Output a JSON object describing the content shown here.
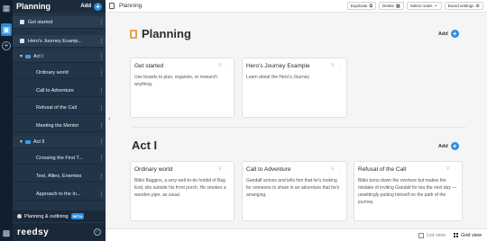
{
  "sidebar": {
    "title": "Planning",
    "add_label": "Add",
    "items": [
      {
        "label": "Get started",
        "kind": "board"
      },
      {
        "label": "Hero's Journey Examp...",
        "kind": "board"
      },
      {
        "label": "Act I",
        "kind": "section"
      },
      {
        "label": "Ordinary world",
        "kind": "card"
      },
      {
        "label": "Call to Adventure",
        "kind": "card"
      },
      {
        "label": "Refusal of the Call",
        "kind": "card"
      },
      {
        "label": "Meeting the Mentor",
        "kind": "card"
      },
      {
        "label": "Act II",
        "kind": "section"
      },
      {
        "label": "Crossing the First T...",
        "kind": "card"
      },
      {
        "label": "Test, Allies, Enemies",
        "kind": "card"
      },
      {
        "label": "Approach to the In...",
        "kind": "card"
      }
    ],
    "footer": {
      "planning_label": "Planning & outlining",
      "beta": "BETA",
      "logo": "reedsy"
    }
  },
  "topbar": {
    "title": "Planning",
    "duplicate": "Duplicate",
    "delete": "Delete",
    "select_notes": "Select notes",
    "board_settings": "Board settings"
  },
  "main": {
    "planning": {
      "title": "Planning",
      "add_label": "Add",
      "cards": [
        {
          "title": "Get started",
          "body": "Use boards to plan, organize, or research anything."
        },
        {
          "title": "Hero's Journey Example",
          "body": "Learn about the Hero's Journey."
        }
      ]
    },
    "act1": {
      "title": "Act I",
      "add_label": "Add",
      "cards": [
        {
          "title": "Ordinary world",
          "body": "Bilbo Baggins, a very well-to-do hobbit of Bag End, sits outside his front porch. He smokes a wooden pipe, as usual."
        },
        {
          "title": "Call to Adventure",
          "body": "Gandalf arrives and tells him that he's looking for someone to share in an adventure that he's arranging."
        },
        {
          "title": "Refusal of the Call",
          "body": "Bilbo turns down the overture but makes the mistake of inviting Gandalf for tea the next day — unwittingly putting himself on the path of the journey."
        }
      ]
    }
  },
  "bottombar": {
    "list_view": "List view",
    "grid_view": "Grid view"
  },
  "colors": {
    "accent": "#2b8cde",
    "sidebar_bg": "#223447",
    "rail_bg": "#0f1f2e",
    "section_icon": "#e7a24c"
  }
}
